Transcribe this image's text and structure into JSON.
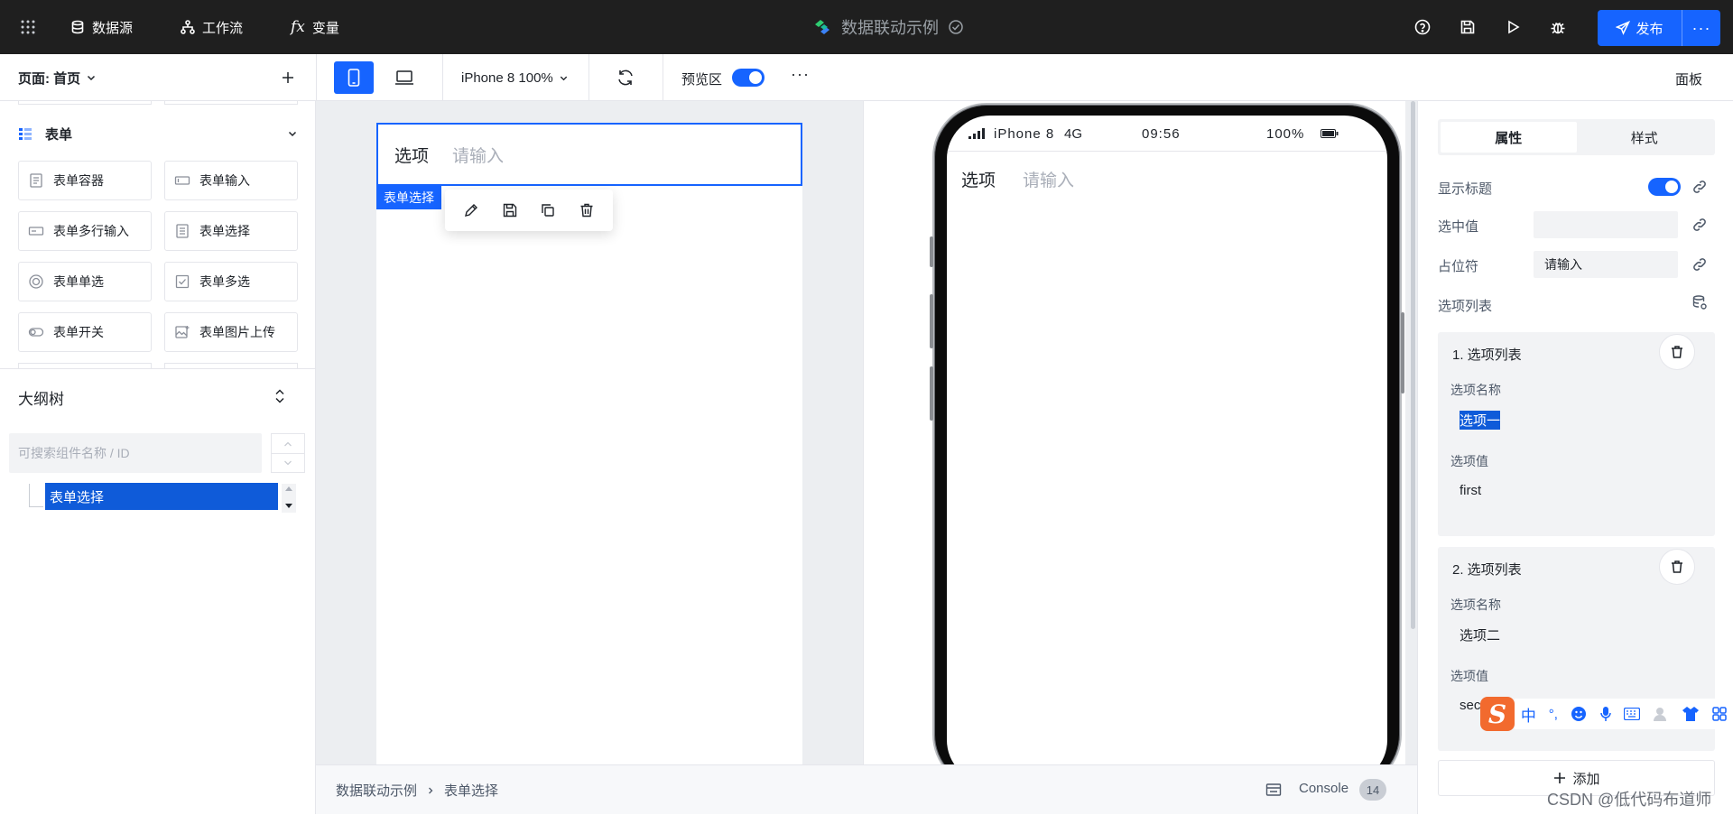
{
  "topbar": {
    "datasource": "数据源",
    "workflow": "工作流",
    "variables": "变量",
    "app_title": "数据联动示例",
    "publish": "发布",
    "more": "···"
  },
  "toolbar": {
    "page_label": "页面: 首页",
    "device": "iPhone 8 100%",
    "preview_label": "预览区",
    "more": "···",
    "panel": "面板"
  },
  "left": {
    "group_title": "表单",
    "components": [
      {
        "label": "表单容器",
        "icon": "form-container-icon"
      },
      {
        "label": "表单输入",
        "icon": "form-input-icon"
      },
      {
        "label": "表单多行输入",
        "icon": "form-textarea-icon"
      },
      {
        "label": "表单选择",
        "icon": "form-select-icon"
      },
      {
        "label": "表单单选",
        "icon": "form-radio-icon"
      },
      {
        "label": "表单多选",
        "icon": "form-checkbox-icon"
      },
      {
        "label": "表单开关",
        "icon": "form-switch-icon"
      },
      {
        "label": "表单图片上传",
        "icon": "form-image-upload-icon"
      }
    ],
    "outline_title": "大纲树",
    "search_placeholder": "可搜索组件名称 / ID",
    "tree_selected": "表单选择"
  },
  "canvas": {
    "field_label": "选项",
    "field_placeholder": "请输入",
    "selected_tag": "表单选择",
    "breadcrumb": [
      "数据联动示例",
      "表单选择"
    ],
    "console": "Console",
    "console_count": "14"
  },
  "phone": {
    "carrier": "iPhone 8",
    "network": "4G",
    "time": "09:56",
    "battery": "100%",
    "field_label": "选项",
    "field_placeholder": "请输入"
  },
  "right": {
    "tabs": [
      "属性",
      "样式"
    ],
    "show_title_label": "显示标题",
    "selected_value_label": "选中值",
    "placeholder_label": "占位符",
    "placeholder_value": "请输入",
    "options_label": "选项列表",
    "options": [
      {
        "header": "1. 选项列表",
        "name_label": "选项名称",
        "name": "选项一",
        "value_label": "选项值",
        "value": "first"
      },
      {
        "header": "2. 选项列表",
        "name_label": "选项名称",
        "name": "选项二",
        "value_label": "选项值",
        "value": "sec"
      }
    ],
    "add_label": "添加"
  },
  "ime_bar": {
    "cn": "中",
    "punct": "°,"
  },
  "watermark": "CSDN @低代码布道师",
  "colors": {
    "accent": "#1664ff",
    "topbar": "#1f1f1f"
  }
}
